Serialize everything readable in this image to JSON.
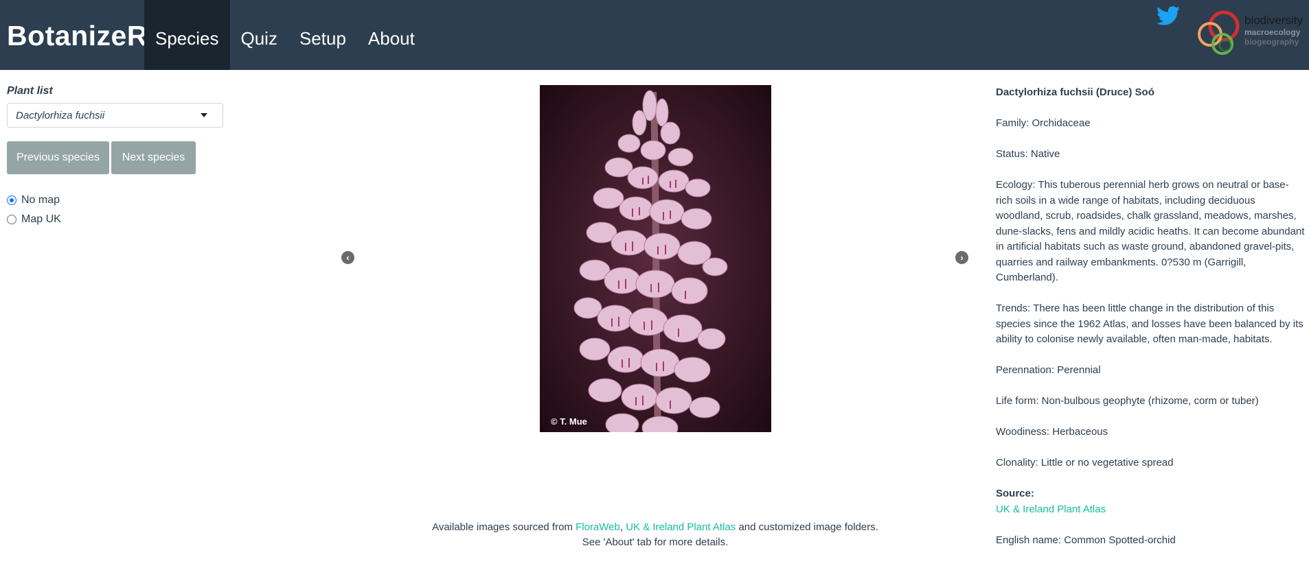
{
  "app": {
    "brand": "BotanizeR",
    "nav": [
      "Species",
      "Quiz",
      "Setup",
      "About"
    ],
    "active_tab": "Species",
    "logo": {
      "line1": "biodiversity",
      "line2": "macroecology",
      "line3": "biogeography"
    },
    "colors": {
      "navbar": "#2c3e50",
      "active_tab": "#1a252f",
      "link": "#18bc9c",
      "button": "#95a5a6"
    }
  },
  "sidebar": {
    "plant_list_label": "Plant list",
    "selected_species": "Dactylorhiza fuchsii",
    "prev_button": "Previous species",
    "next_button": "Next species",
    "map_options": [
      "No map",
      "Map UK"
    ],
    "selected_map": "No map"
  },
  "image": {
    "copyright": "© T. Mue"
  },
  "caption": {
    "prefix": "Available images sourced from ",
    "link1": "FloraWeb",
    "sep": ", ",
    "link2": "UK & Ireland Plant Atlas",
    "suffix": " and customized image folders.",
    "line2": "See 'About' tab for more details."
  },
  "info": {
    "name": "Dactylorhiza fuchsii (Druce) Soó",
    "family": "Family: Orchidaceae",
    "status": "Status: Native",
    "ecology": "Ecology: This tuberous perennial herb grows on neutral or base-rich soils in a wide range of habitats, including deciduous woodland, scrub, roadsides, chalk grassland, meadows, marshes, dune-slacks, fens and mildly acidic heaths. It can become abundant in artificial habitats such as waste ground, abandoned gravel-pits, quarries and railway embankments. 0?530 m (Garrigill, Cumberland).",
    "trends": "Trends: There has been little change in the distribution of this species since the 1962 Atlas, and losses have been balanced by its ability to colonise newly available, often man-made, habitats.",
    "perennation": "Perennation: Perennial",
    "life_form": "Life form: Non-bulbous geophyte (rhizome, corm or tuber)",
    "woodiness": "Woodiness: Herbaceous",
    "clonality": "Clonality: Little or no vegetative spread",
    "source_label": "Source:",
    "source_link": "UK & Ireland Plant Atlas",
    "english_name": "English name: Common Spotted-orchid"
  }
}
